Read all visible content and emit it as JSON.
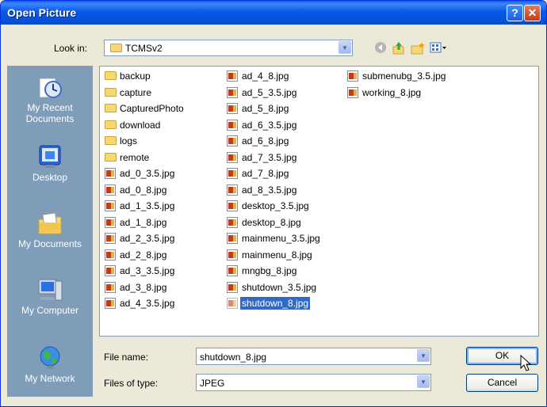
{
  "window": {
    "title": "Open Picture"
  },
  "titlebar": {
    "help": "?",
    "close": "✕"
  },
  "toolbar": {
    "lookin_label": "Look in:",
    "lookin_value": "TCMSv2",
    "icons": [
      "back-icon",
      "up-folder-icon",
      "new-folder-icon",
      "views-menu-icon"
    ]
  },
  "places": [
    {
      "name": "recent",
      "label": "My Recent Documents"
    },
    {
      "name": "desktop",
      "label": "Desktop"
    },
    {
      "name": "documents",
      "label": "My Documents"
    },
    {
      "name": "computer",
      "label": "My Computer"
    },
    {
      "name": "network",
      "label": "My Network"
    }
  ],
  "files": {
    "col1": [
      {
        "label": "backup",
        "type": "folder"
      },
      {
        "label": "capture",
        "type": "folder"
      },
      {
        "label": "CapturedPhoto",
        "type": "folder"
      },
      {
        "label": "download",
        "type": "folder"
      },
      {
        "label": "logs",
        "type": "folder"
      },
      {
        "label": "remote",
        "type": "folder"
      },
      {
        "label": "ad_0_3.5.jpg",
        "type": "image"
      },
      {
        "label": "ad_0_8.jpg",
        "type": "image"
      },
      {
        "label": "ad_1_3.5.jpg",
        "type": "image"
      },
      {
        "label": "ad_1_8.jpg",
        "type": "image"
      },
      {
        "label": "ad_2_3.5.jpg",
        "type": "image"
      },
      {
        "label": "ad_2_8.jpg",
        "type": "image"
      },
      {
        "label": "ad_3_3.5.jpg",
        "type": "image"
      },
      {
        "label": "ad_3_8.jpg",
        "type": "image"
      },
      {
        "label": "ad_4_3.5.jpg",
        "type": "image"
      }
    ],
    "col2": [
      {
        "label": "ad_4_8.jpg",
        "type": "image"
      },
      {
        "label": "ad_5_3.5.jpg",
        "type": "image"
      },
      {
        "label": "ad_5_8.jpg",
        "type": "image"
      },
      {
        "label": "ad_6_3.5.jpg",
        "type": "image"
      },
      {
        "label": "ad_6_8.jpg",
        "type": "image"
      },
      {
        "label": "ad_7_3.5.jpg",
        "type": "image"
      },
      {
        "label": "ad_7_8.jpg",
        "type": "image"
      },
      {
        "label": "ad_8_3.5.jpg",
        "type": "image"
      },
      {
        "label": "desktop_3.5.jpg",
        "type": "image"
      },
      {
        "label": "desktop_8.jpg",
        "type": "image"
      },
      {
        "label": "mainmenu_3.5.jpg",
        "type": "image"
      },
      {
        "label": "mainmenu_8.jpg",
        "type": "image"
      },
      {
        "label": "mngbg_8.jpg",
        "type": "image"
      },
      {
        "label": "shutdown_3.5.jpg",
        "type": "image"
      },
      {
        "label": "shutdown_8.jpg",
        "type": "image",
        "selected": true
      }
    ],
    "col3": [
      {
        "label": "submenubg_3.5.jpg",
        "type": "image"
      },
      {
        "label": "working_8.jpg",
        "type": "image"
      }
    ]
  },
  "filename": {
    "label": "File name:",
    "value": "shutdown_8.jpg"
  },
  "filetype": {
    "label": "Files of type:",
    "value": "JPEG"
  },
  "buttons": {
    "ok": "OK",
    "cancel": "Cancel"
  }
}
